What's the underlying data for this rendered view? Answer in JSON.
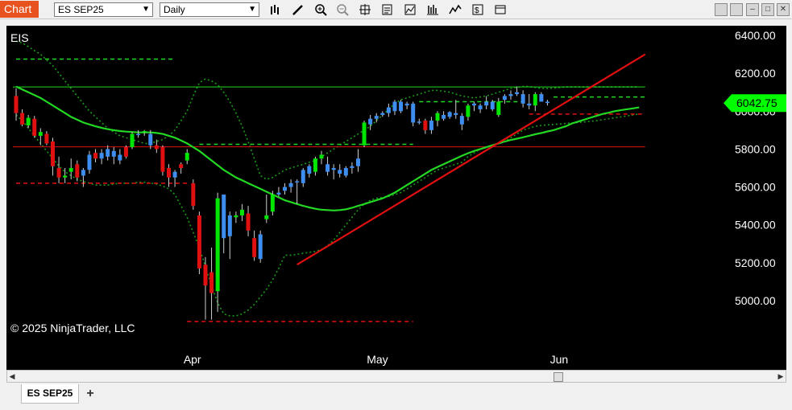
{
  "window": {
    "tag": "Chart",
    "instrument_select": "ES SEP25",
    "period_select": "Daily"
  },
  "toolbar_icons": [
    "bar-type-icon",
    "draw-pencil-icon",
    "zoom-in-icon",
    "zoom-out-icon",
    "crosshair-icon",
    "data-box-icon",
    "indicators-icon",
    "strategies-icon",
    "chart-properties-icon",
    "more-icon"
  ],
  "chart": {
    "symbol": "EIS",
    "copyright": "© 2025 NinjaTrader, LLC",
    "last_price_label": "6042.75",
    "colors": {
      "up": "#00e600",
      "up_blue": "#3d8ef0",
      "down": "#e01010",
      "sma": "#22d822",
      "trend": "#e01010"
    }
  },
  "tabs": {
    "active": "ES SEP25",
    "add": "+"
  },
  "chart_data": {
    "type": "candlestick",
    "ylim": [
      4850,
      6450
    ],
    "y_ticks": [
      5000,
      5200,
      5400,
      5600,
      5800,
      6000,
      6200,
      6400
    ],
    "y_tick_labels": [
      "5000.00",
      "5200.00",
      "5400.00",
      "5600.00",
      "5800.00",
      "6000.00",
      "6200.00",
      "6400.00"
    ],
    "x_labels": [
      {
        "label": "Apr",
        "bar": 29
      },
      {
        "label": "May",
        "bar": 59
      },
      {
        "label": "Jun",
        "bar": 89
      }
    ],
    "last_price": 6042.75,
    "candles": [
      {
        "o": 6080,
        "h": 6120,
        "l": 5950,
        "c": 5990,
        "k": "d"
      },
      {
        "o": 5990,
        "h": 6010,
        "l": 5920,
        "c": 5930,
        "k": "d"
      },
      {
        "o": 5925,
        "h": 5980,
        "l": 5910,
        "c": 5965,
        "k": "u"
      },
      {
        "o": 5960,
        "h": 5975,
        "l": 5860,
        "c": 5870,
        "k": "d"
      },
      {
        "o": 5870,
        "h": 5910,
        "l": 5820,
        "c": 5890,
        "k": "u"
      },
      {
        "o": 5880,
        "h": 5895,
        "l": 5820,
        "c": 5830,
        "k": "d"
      },
      {
        "o": 5840,
        "h": 5860,
        "l": 5660,
        "c": 5710,
        "k": "d"
      },
      {
        "o": 5700,
        "h": 5760,
        "l": 5620,
        "c": 5650,
        "k": "d"
      },
      {
        "o": 5650,
        "h": 5700,
        "l": 5620,
        "c": 5660,
        "k": "u"
      },
      {
        "o": 5680,
        "h": 5750,
        "l": 5640,
        "c": 5700,
        "k": "u"
      },
      {
        "o": 5720,
        "h": 5740,
        "l": 5630,
        "c": 5650,
        "k": "d"
      },
      {
        "o": 5660,
        "h": 5700,
        "l": 5600,
        "c": 5690,
        "k": "b"
      },
      {
        "o": 5690,
        "h": 5790,
        "l": 5670,
        "c": 5770,
        "k": "b"
      },
      {
        "o": 5780,
        "h": 5800,
        "l": 5730,
        "c": 5750,
        "k": "d"
      },
      {
        "o": 5750,
        "h": 5800,
        "l": 5720,
        "c": 5780,
        "k": "b"
      },
      {
        "o": 5760,
        "h": 5820,
        "l": 5740,
        "c": 5800,
        "k": "b"
      },
      {
        "o": 5790,
        "h": 5810,
        "l": 5720,
        "c": 5760,
        "k": "b"
      },
      {
        "o": 5770,
        "h": 5800,
        "l": 5720,
        "c": 5740,
        "k": "b"
      },
      {
        "o": 5810,
        "h": 5820,
        "l": 5750,
        "c": 5760,
        "k": "d"
      },
      {
        "o": 5810,
        "h": 5890,
        "l": 5800,
        "c": 5880,
        "k": "u"
      },
      {
        "o": 5880,
        "h": 5900,
        "l": 5860,
        "c": 5880,
        "k": "b"
      },
      {
        "o": 5890,
        "h": 5900,
        "l": 5870,
        "c": 5895,
        "k": "u"
      },
      {
        "o": 5880,
        "h": 5900,
        "l": 5800,
        "c": 5820,
        "k": "b"
      },
      {
        "o": 5820,
        "h": 5850,
        "l": 5780,
        "c": 5800,
        "k": "d"
      },
      {
        "o": 5810,
        "h": 5820,
        "l": 5660,
        "c": 5680,
        "k": "d"
      },
      {
        "o": 5700,
        "h": 5720,
        "l": 5600,
        "c": 5650,
        "k": "d"
      },
      {
        "o": 5650,
        "h": 5690,
        "l": 5600,
        "c": 5680,
        "k": "b"
      },
      {
        "o": 5700,
        "h": 5730,
        "l": 5670,
        "c": 5720,
        "k": "d"
      },
      {
        "o": 5740,
        "h": 5800,
        "l": 5720,
        "c": 5780,
        "k": "u"
      },
      {
        "o": 5620,
        "h": 5640,
        "l": 5480,
        "c": 5500,
        "k": "d"
      },
      {
        "o": 5450,
        "h": 5470,
        "l": 5140,
        "c": 5170,
        "k": "d"
      },
      {
        "o": 5190,
        "h": 5230,
        "l": 4900,
        "c": 5080,
        "k": "d"
      },
      {
        "o": 5150,
        "h": 5280,
        "l": 4900,
        "c": 5040,
        "k": "d"
      },
      {
        "o": 5050,
        "h": 5570,
        "l": 4940,
        "c": 5540,
        "k": "u"
      },
      {
        "o": 5560,
        "h": 5560,
        "l": 5250,
        "c": 5330,
        "k": "b"
      },
      {
        "o": 5340,
        "h": 5470,
        "l": 5220,
        "c": 5450,
        "k": "b"
      },
      {
        "o": 5450,
        "h": 5470,
        "l": 5410,
        "c": 5440,
        "k": "u"
      },
      {
        "o": 5450,
        "h": 5510,
        "l": 5420,
        "c": 5480,
        "k": "u"
      },
      {
        "o": 5460,
        "h": 5500,
        "l": 5340,
        "c": 5370,
        "k": "d"
      },
      {
        "o": 5330,
        "h": 5370,
        "l": 5210,
        "c": 5230,
        "k": "d"
      },
      {
        "o": 5220,
        "h": 5370,
        "l": 5200,
        "c": 5350,
        "k": "b"
      },
      {
        "o": 5430,
        "h": 5560,
        "l": 5410,
        "c": 5450,
        "k": "u"
      },
      {
        "o": 5470,
        "h": 5580,
        "l": 5450,
        "c": 5560,
        "k": "u"
      },
      {
        "o": 5560,
        "h": 5600,
        "l": 5550,
        "c": 5570,
        "k": "b"
      },
      {
        "o": 5580,
        "h": 5620,
        "l": 5560,
        "c": 5600,
        "k": "b"
      },
      {
        "o": 5600,
        "h": 5640,
        "l": 5570,
        "c": 5620,
        "k": "b"
      },
      {
        "o": 5625,
        "h": 5640,
        "l": 5510,
        "c": 5630,
        "k": "b"
      },
      {
        "o": 5620,
        "h": 5700,
        "l": 5600,
        "c": 5690,
        "k": "b"
      },
      {
        "o": 5670,
        "h": 5720,
        "l": 5650,
        "c": 5710,
        "k": "b"
      },
      {
        "o": 5680,
        "h": 5760,
        "l": 5660,
        "c": 5750,
        "k": "u"
      },
      {
        "o": 5750,
        "h": 5790,
        "l": 5720,
        "c": 5770,
        "k": "u"
      },
      {
        "o": 5720,
        "h": 5760,
        "l": 5660,
        "c": 5680,
        "k": "b"
      },
      {
        "o": 5690,
        "h": 5720,
        "l": 5640,
        "c": 5700,
        "k": "b"
      },
      {
        "o": 5690,
        "h": 5720,
        "l": 5650,
        "c": 5670,
        "k": "b"
      },
      {
        "o": 5660,
        "h": 5710,
        "l": 5650,
        "c": 5700,
        "k": "b"
      },
      {
        "o": 5700,
        "h": 5730,
        "l": 5670,
        "c": 5710,
        "k": "b"
      },
      {
        "o": 5710,
        "h": 5800,
        "l": 5680,
        "c": 5750,
        "k": "b"
      },
      {
        "o": 5820,
        "h": 5950,
        "l": 5810,
        "c": 5940,
        "k": "u"
      },
      {
        "o": 5930,
        "h": 5980,
        "l": 5900,
        "c": 5960,
        "k": "b"
      },
      {
        "o": 5960,
        "h": 5990,
        "l": 5940,
        "c": 5975,
        "k": "b"
      },
      {
        "o": 5980,
        "h": 6000,
        "l": 5970,
        "c": 5990,
        "k": "b"
      },
      {
        "o": 5990,
        "h": 6040,
        "l": 5970,
        "c": 6020,
        "k": "b"
      },
      {
        "o": 6000,
        "h": 6060,
        "l": 5980,
        "c": 6050,
        "k": "b"
      },
      {
        "o": 6050,
        "h": 6060,
        "l": 5990,
        "c": 6000,
        "k": "b"
      },
      {
        "o": 6030,
        "h": 6050,
        "l": 6010,
        "c": 6040,
        "k": "b"
      },
      {
        "o": 6040,
        "h": 6050,
        "l": 5920,
        "c": 5940,
        "k": "b"
      },
      {
        "o": 5940,
        "h": 5960,
        "l": 5930,
        "c": 5945,
        "k": "b"
      },
      {
        "o": 5950,
        "h": 5960,
        "l": 5880,
        "c": 5900,
        "k": "d"
      },
      {
        "o": 5900,
        "h": 5970,
        "l": 5880,
        "c": 5950,
        "k": "b"
      },
      {
        "o": 5950,
        "h": 6000,
        "l": 5920,
        "c": 5990,
        "k": "u"
      },
      {
        "o": 5980,
        "h": 6000,
        "l": 5950,
        "c": 5960,
        "k": "b"
      },
      {
        "o": 5970,
        "h": 6000,
        "l": 5960,
        "c": 5995,
        "k": "b"
      },
      {
        "o": 5980,
        "h": 6060,
        "l": 5960,
        "c": 5990,
        "k": "b"
      },
      {
        "o": 5930,
        "h": 5990,
        "l": 5900,
        "c": 5975,
        "k": "b"
      },
      {
        "o": 5970,
        "h": 6040,
        "l": 5950,
        "c": 6030,
        "k": "u"
      },
      {
        "o": 6030,
        "h": 6050,
        "l": 6000,
        "c": 6040,
        "k": "b"
      },
      {
        "o": 6010,
        "h": 6040,
        "l": 5990,
        "c": 6030,
        "k": "b"
      },
      {
        "o": 6030,
        "h": 6080,
        "l": 6010,
        "c": 6050,
        "k": "b"
      },
      {
        "o": 6050,
        "h": 6060,
        "l": 6000,
        "c": 6010,
        "k": "b"
      },
      {
        "o": 5980,
        "h": 6070,
        "l": 5970,
        "c": 6050,
        "k": "u"
      },
      {
        "o": 6060,
        "h": 6090,
        "l": 6040,
        "c": 6080,
        "k": "b"
      },
      {
        "o": 6080,
        "h": 6110,
        "l": 6060,
        "c": 6090,
        "k": "b"
      },
      {
        "o": 6100,
        "h": 6130,
        "l": 6080,
        "c": 6090,
        "k": "b"
      },
      {
        "o": 6090,
        "h": 6110,
        "l": 6020,
        "c": 6040,
        "k": "b"
      },
      {
        "o": 6040,
        "h": 6090,
        "l": 6010,
        "c": 6030,
        "k": "b"
      },
      {
        "o": 6030,
        "h": 6100,
        "l": 6000,
        "c": 6090,
        "k": "u"
      },
      {
        "o": 6090,
        "h": 6100,
        "l": 6050,
        "c": 6050,
        "k": "b"
      },
      {
        "o": 6050,
        "h": 6060,
        "l": 6030,
        "c": 6043,
        "k": "b"
      }
    ],
    "sma": [
      6130,
      6115,
      6100,
      6085,
      6070,
      6050,
      6030,
      6010,
      5990,
      5970,
      5955,
      5940,
      5930,
      5920,
      5912,
      5905,
      5900,
      5895,
      5892,
      5890,
      5888,
      5888,
      5888,
      5885,
      5880,
      5870,
      5860,
      5845,
      5830,
      5810,
      5790,
      5765,
      5740,
      5715,
      5690,
      5670,
      5650,
      5635,
      5620,
      5605,
      5590,
      5575,
      5560,
      5545,
      5530,
      5520,
      5510,
      5500,
      5492,
      5485,
      5480,
      5478,
      5476,
      5478,
      5482,
      5490,
      5500,
      5510,
      5520,
      5530,
      5540,
      5555,
      5570,
      5590,
      5610,
      5630,
      5650,
      5670,
      5690,
      5705,
      5720,
      5735,
      5750,
      5765,
      5778,
      5790,
      5800,
      5810,
      5820,
      5830,
      5840,
      5848,
      5855,
      5862,
      5870,
      5878,
      5885,
      5893,
      5900,
      5910,
      5920,
      5935,
      5945,
      5955,
      5965,
      5975,
      5985,
      5992,
      6000,
      6005,
      6010,
      6015,
      6020
    ],
    "bb_upper": [
      6370,
      6360,
      6340,
      6320,
      6300,
      6270,
      6240,
      6200,
      6160,
      6120,
      6080,
      6040,
      6000,
      5970,
      5940,
      5910,
      5890,
      5870,
      5860,
      5850,
      5840,
      5830,
      5830,
      5840,
      5850,
      5870,
      5900,
      5950,
      6000,
      6080,
      6150,
      6170,
      6160,
      6140,
      6100,
      6050,
      5990,
      5920,
      5840,
      5750,
      5660,
      5640,
      5650,
      5670,
      5690,
      5700,
      5710,
      5720,
      5730,
      5740,
      5760,
      5780,
      5800,
      5820,
      5840,
      5860,
      5880,
      5900,
      5920,
      5950,
      5980,
      6010,
      6040,
      6060,
      6070,
      6080,
      6090,
      6100,
      6110,
      6110,
      6105,
      6100,
      6090,
      6080,
      6075,
      6070,
      6075,
      6080,
      6090,
      6100,
      6110,
      6120,
      6125,
      6130,
      6130,
      6125,
      6120,
      6120,
      6122,
      6125,
      6128,
      6128,
      6128,
      6128,
      6128,
      6128,
      6128,
      6128,
      6128,
      6128,
      6128,
      6128,
      6128
    ],
    "bb_lower": [
      5980,
      5950,
      5910,
      5870,
      5830,
      5790,
      5750,
      5710,
      5680,
      5660,
      5640,
      5630,
      5620,
      5610,
      5610,
      5610,
      5615,
      5620,
      5620,
      5620,
      5625,
      5625,
      5620,
      5615,
      5605,
      5590,
      5560,
      5500,
      5440,
      5360,
      5280,
      5180,
      5080,
      4990,
      4930,
      4920,
      4920,
      4930,
      4950,
      4980,
      5020,
      5060,
      5110,
      5170,
      5240,
      5240,
      5245,
      5250,
      5255,
      5260,
      5270,
      5290,
      5320,
      5360,
      5400,
      5440,
      5480,
      5510,
      5530,
      5540,
      5545,
      5550,
      5560,
      5570,
      5590,
      5610,
      5630,
      5650,
      5670,
      5690,
      5700,
      5710,
      5720,
      5730,
      5760,
      5780,
      5800,
      5810,
      5820,
      5830,
      5840,
      5860,
      5880,
      5900,
      5910,
      5920,
      5925,
      5928,
      5930,
      5932,
      5935,
      5938,
      5940,
      5943,
      5946,
      5950,
      5955,
      5960,
      5965,
      5970,
      5975,
      5980,
      5985
    ],
    "hlines_solid": [
      {
        "y": 6128,
        "x0": 0,
        "x1": 103,
        "color": "#22d822"
      },
      {
        "y": 5812,
        "x0": 0,
        "x1": 103,
        "color": "#e01010"
      }
    ],
    "hlines_dashed": [
      {
        "y": 6275,
        "x0": 0,
        "x1": 26,
        "color": "#22d822"
      },
      {
        "y": 5825,
        "x0": 30,
        "x1": 65,
        "color": "#22d822"
      },
      {
        "y": 6050,
        "x0": 66,
        "x1": 83,
        "color": "#22d822"
      },
      {
        "y": 6075,
        "x0": 88,
        "x1": 103,
        "color": "#22d822"
      },
      {
        "y": 5620,
        "x0": 0,
        "x1": 28,
        "color": "#e01010"
      },
      {
        "y": 4890,
        "x0": 28,
        "x1": 65,
        "color": "#e01010"
      },
      {
        "y": 5985,
        "x0": 84,
        "x1": 103,
        "color": "#e01010"
      }
    ],
    "trendline": {
      "x0": 46,
      "y0": 5190,
      "x1": 103,
      "y1": 6300
    }
  }
}
